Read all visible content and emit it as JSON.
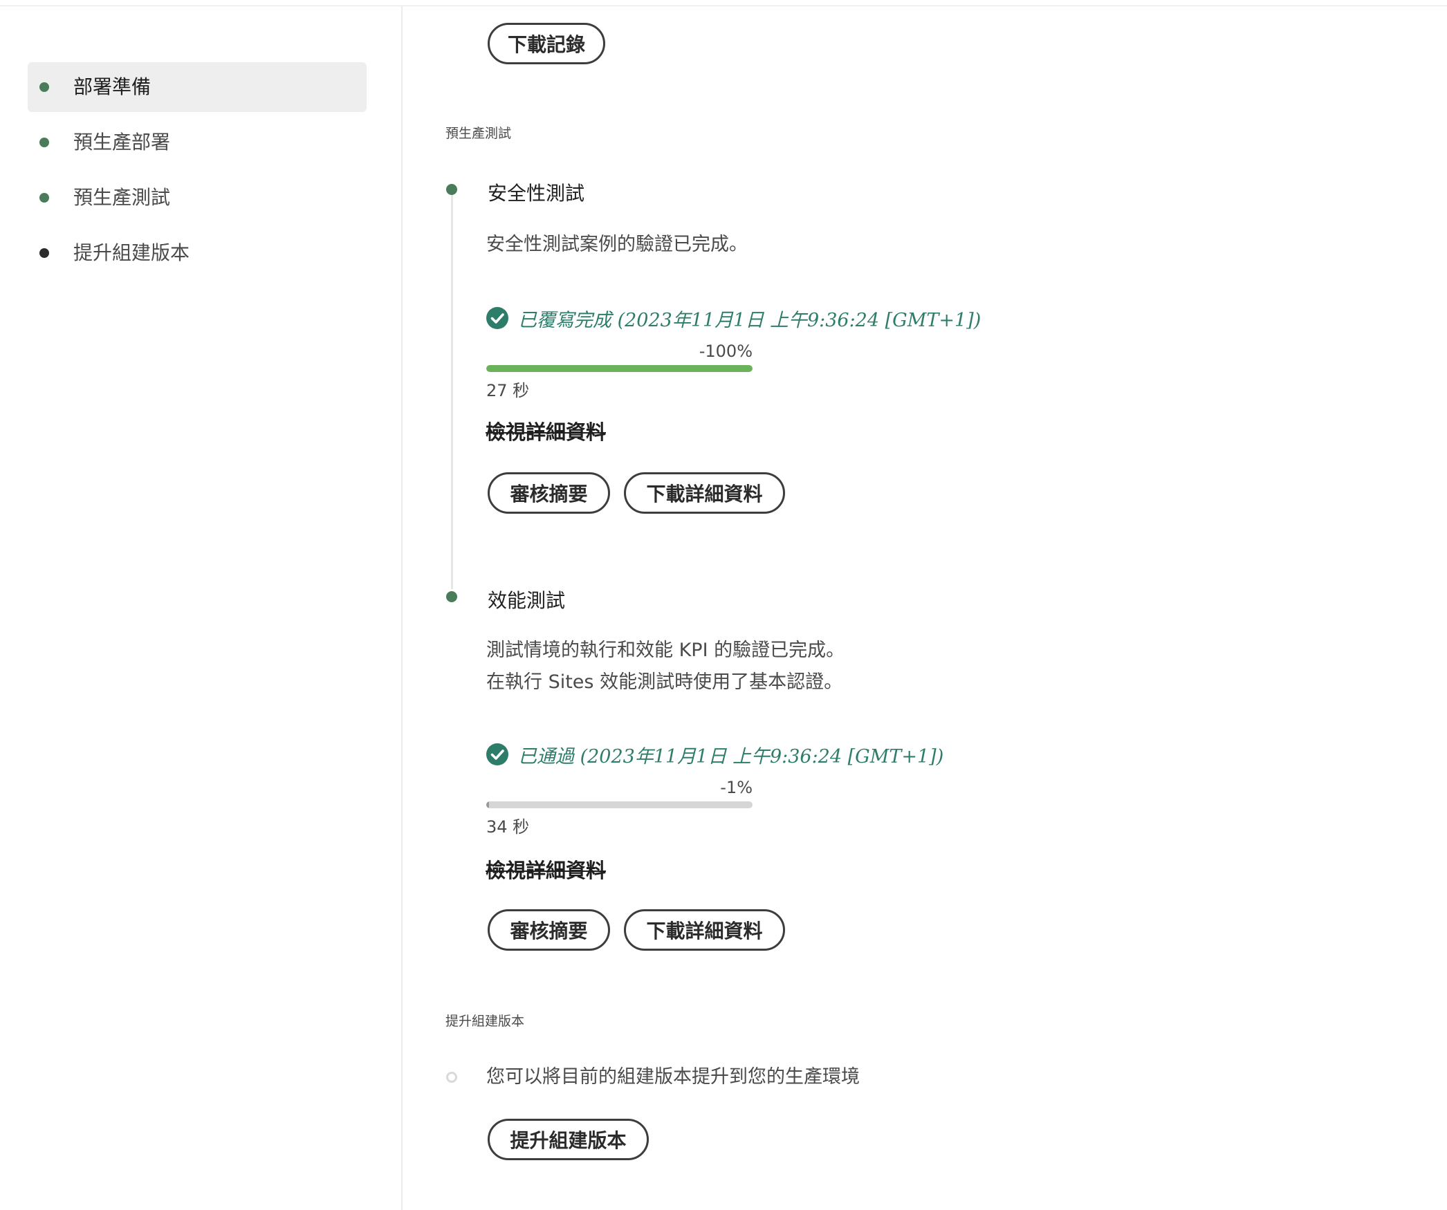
{
  "colors": {
    "accent_green": "#4a7c59",
    "dark_dot": "#2b2b2b",
    "status_teal": "#2e7d6a",
    "progress_green": "#6bb35a",
    "progress_gray": "#cfcfcf"
  },
  "sidebar": {
    "items": [
      {
        "label": "部署準備",
        "active": true,
        "dot_color": "#4a7c59"
      },
      {
        "label": "預生產部署",
        "active": false,
        "dot_color": "#4a7c59"
      },
      {
        "label": "預生產測試",
        "active": false,
        "dot_color": "#4a7c59"
      },
      {
        "label": "提升組建版本",
        "active": false,
        "dot_color": "#2b2b2b"
      }
    ]
  },
  "main": {
    "top_button": "下載記錄",
    "preprod_section_label": "預生產測試",
    "steps": [
      {
        "title": "安全性測試",
        "description": [
          "安全性測試案例的驗證已完成。"
        ],
        "status_icon": "check-circle-icon",
        "status": "已覆寫完成 (2023年11月1日 上午9:36:24 [GMT+1])",
        "percent_label": "-100%",
        "progress": 1.0,
        "duration": "27 秒",
        "details_link": "檢視詳細資料",
        "buttons": [
          "審核摘要",
          "下載詳細資料"
        ]
      },
      {
        "title": "效能測試",
        "description": [
          "測試情境的執行和效能 KPI 的驗證已完成。",
          "在執行 Sites 效能測試時使用了基本認證。"
        ],
        "status_icon": "check-circle-icon",
        "status": "已通過 (2023年11月1日 上午9:36:24 [GMT+1])",
        "percent_label": "-1%",
        "progress": 0.01,
        "duration": "34 秒",
        "details_link": "檢視詳細資料",
        "buttons": [
          "審核摘要",
          "下載詳細資料"
        ]
      }
    ],
    "promote": {
      "section_label": "提升組建版本",
      "description": "您可以將目前的組建版本提升到您的生產環境",
      "button": "提升組建版本"
    }
  }
}
